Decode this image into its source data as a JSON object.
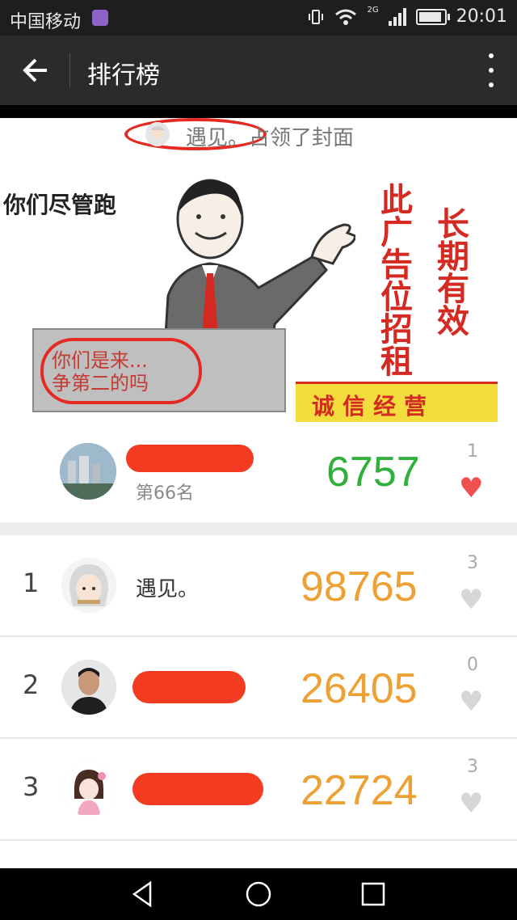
{
  "status_bar": {
    "carrier": "中国移动",
    "network": "2G",
    "time": "20:01"
  },
  "toolbar": {
    "title": "排行榜"
  },
  "cover": {
    "user_text": "遇见。占领了封面",
    "slogan": "你们尽管跑",
    "podium_text_line1": "你们是来...",
    "podium_text_line2": "争第二的吗",
    "ad_col1": "此广告位招租",
    "ad_col2": "长期有效",
    "banner_text": "诚信经营"
  },
  "my_rank": {
    "rank_label": "第66名",
    "steps": "6757",
    "likes": "1"
  },
  "ranking": [
    {
      "rank": "1",
      "name": "遇见。",
      "steps": "98765",
      "likes": "3"
    },
    {
      "rank": "2",
      "name": "",
      "steps": "26405",
      "likes": "0"
    },
    {
      "rank": "3",
      "name": "",
      "steps": "22724",
      "likes": "3"
    }
  ],
  "colors": {
    "accent_red": "#f23b20",
    "my_steps_green": "#2fb03b",
    "steps_orange": "#eda033"
  }
}
